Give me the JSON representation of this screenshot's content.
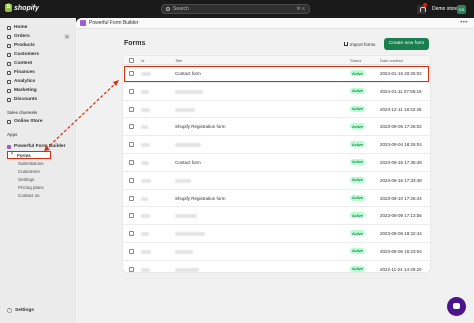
{
  "topbar": {
    "brand": "shopify",
    "search_placeholder": "Search",
    "search_shortcut": "⌘ K",
    "store_name": "Demo store",
    "avatar_initials": "DS"
  },
  "sidebar": {
    "items": [
      {
        "label": "Home",
        "icon": "home-icon"
      },
      {
        "label": "Orders",
        "icon": "orders-icon",
        "badge": "3"
      },
      {
        "label": "Products",
        "icon": "tag-icon"
      },
      {
        "label": "Customers",
        "icon": "person-icon"
      },
      {
        "label": "Content",
        "icon": "content-icon"
      },
      {
        "label": "Finances",
        "icon": "bank-icon"
      },
      {
        "label": "Analytics",
        "icon": "chart-icon"
      },
      {
        "label": "Marketing",
        "icon": "target-icon"
      },
      {
        "label": "Discounts",
        "icon": "discount-icon"
      }
    ],
    "sales_channels_label": "Sales channels",
    "online_store": "Online Store",
    "apps_label": "Apps",
    "app_name": "Powerful Form Builder",
    "app_subitems": [
      "Forms",
      "Submissions",
      "Customers",
      "Settings",
      "Pricing plans",
      "Contact us"
    ],
    "settings": "Settings"
  },
  "app_header": {
    "title": "Powerful Form Builder",
    "more": "•••"
  },
  "page": {
    "title": "Forms",
    "import_label": "Import forms",
    "create_label": "Create new form"
  },
  "table": {
    "headers": {
      "id": "Id",
      "title": "Title",
      "status": "Status",
      "date": "Date created"
    },
    "rows": [
      {
        "title": "Contact form",
        "status": "Active",
        "date": "2024-01-16 20:26:02"
      },
      {
        "title": "",
        "status": "Active",
        "date": "2024-01-11 07:55:18"
      },
      {
        "title": "",
        "status": "Active",
        "date": "2023-12-11 18:42:26"
      },
      {
        "title": "Shopify Registration form",
        "status": "Active",
        "date": "2023-09-05 17:26:02"
      },
      {
        "title": "",
        "status": "Active",
        "date": "2023-09-04 18:26:04"
      },
      {
        "title": "Contact form",
        "status": "Active",
        "date": "2023-08-16 17:35:49"
      },
      {
        "title": "",
        "status": "Active",
        "date": "2023-08-16 17:33:48"
      },
      {
        "title": "Shopify Registration form",
        "status": "Active",
        "date": "2023-08-10 17:26:44"
      },
      {
        "title": "",
        "status": "Active",
        "date": "2023-08-09 17:13:56"
      },
      {
        "title": "",
        "status": "Active",
        "date": "2023-08-06 18:22:44"
      },
      {
        "title": "",
        "status": "Active",
        "date": "2023-08-06 15:23:04"
      },
      {
        "title": "",
        "status": "Active",
        "date": "2022-11-24 14:49:20"
      }
    ]
  },
  "colors": {
    "primary_button": "#1a7f4f",
    "highlight": "#d82c0d",
    "status_badge": "#b4fed2"
  }
}
